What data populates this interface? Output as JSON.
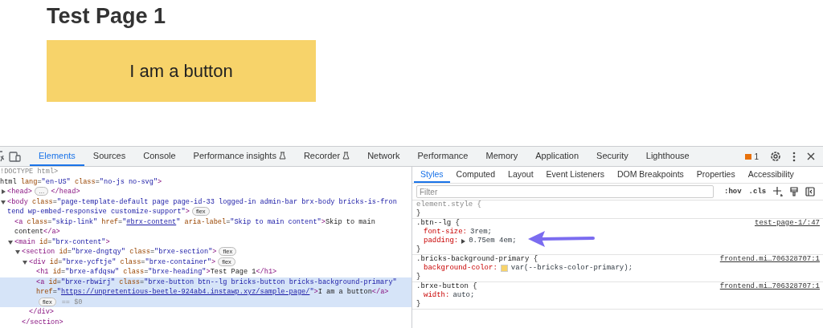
{
  "page": {
    "heading": "Test Page 1",
    "button": "I am a button"
  },
  "devtools": {
    "tabs": [
      {
        "label": "Elements",
        "selected": true,
        "experimental": false
      },
      {
        "label": "Sources",
        "selected": false,
        "experimental": false
      },
      {
        "label": "Console",
        "selected": false,
        "experimental": false
      },
      {
        "label": "Performance insights",
        "selected": false,
        "experimental": true
      },
      {
        "label": "Recorder",
        "selected": false,
        "experimental": true
      },
      {
        "label": "Network",
        "selected": false,
        "experimental": false
      },
      {
        "label": "Performance",
        "selected": false,
        "experimental": false
      },
      {
        "label": "Memory",
        "selected": false,
        "experimental": false
      },
      {
        "label": "Application",
        "selected": false,
        "experimental": false
      },
      {
        "label": "Security",
        "selected": false,
        "experimental": false
      },
      {
        "label": "Lighthouse",
        "selected": false,
        "experimental": false
      }
    ],
    "issues_count": "1"
  },
  "elements": {
    "nodes": [
      {
        "selected": false,
        "lines": [
          [
            {
              "kind": "doctype",
              "text": "!DOCTYPE html>"
            }
          ]
        ]
      },
      {
        "selected": false,
        "lines": [
          [
            {
              "kind": "text",
              "text": "html"
            },
            {
              "kind": "attr",
              "text": " lang"
            },
            {
              "kind": "text",
              "text": "="
            },
            {
              "kind": "value",
              "text": "\"en-US\""
            },
            {
              "kind": "attr",
              "text": " class"
            },
            {
              "kind": "text",
              "text": "="
            },
            {
              "kind": "value",
              "text": "\"no-js no-svg\""
            },
            {
              "kind": "tag",
              "text": ">"
            }
          ]
        ],
        "children": [
          {
            "selected": false,
            "expanded": false,
            "lines": [
              [
                {
                  "kind": "tag",
                  "text": "<head>"
                },
                {
                  "kind": "badge",
                  "text": "…"
                },
                {
                  "kind": "tag",
                  "text": "</head>"
                }
              ]
            ]
          },
          {
            "selected": false,
            "expanded": true,
            "lines": [
              [
                {
                  "kind": "tag",
                  "text": "<body"
                },
                {
                  "kind": "attr",
                  "text": " class"
                },
                {
                  "kind": "text",
                  "text": "="
                },
                {
                  "kind": "value",
                  "text": "\"page-template-default page page-id-33 logged-in admin-bar brx-body bricks-is-fron"
                }
              ],
              [
                {
                  "kind": "value",
                  "text": "tend wp-embed-responsive customize-support\""
                },
                {
                  "kind": "tag",
                  "text": ">"
                },
                {
                  "kind": "badge",
                  "text": "flex"
                }
              ]
            ],
            "children": [
              {
                "selected": false,
                "lines": [
                  [
                    {
                      "kind": "tag",
                      "text": "<a"
                    },
                    {
                      "kind": "attr",
                      "text": " class"
                    },
                    {
                      "kind": "text",
                      "text": "="
                    },
                    {
                      "kind": "value",
                      "text": "\"skip-link\""
                    },
                    {
                      "kind": "attr",
                      "text": " href"
                    },
                    {
                      "kind": "text",
                      "text": "="
                    },
                    {
                      "kind": "value",
                      "text": "\""
                    },
                    {
                      "kind": "link",
                      "text": "#brx-content"
                    },
                    {
                      "kind": "value",
                      "text": "\""
                    },
                    {
                      "kind": "attr",
                      "text": " aria-label"
                    },
                    {
                      "kind": "text",
                      "text": "="
                    },
                    {
                      "kind": "value",
                      "text": "\"Skip to main content\""
                    },
                    {
                      "kind": "tag",
                      "text": ">"
                    },
                    {
                      "kind": "text",
                      "text": "Skip to main"
                    }
                  ],
                  [
                    {
                      "kind": "text",
                      "text": "content"
                    },
                    {
                      "kind": "tag",
                      "text": "</a>"
                    }
                  ]
                ]
              },
              {
                "selected": false,
                "expanded": true,
                "lines": [
                  [
                    {
                      "kind": "tag",
                      "text": "<main"
                    },
                    {
                      "kind": "attr",
                      "text": " id"
                    },
                    {
                      "kind": "text",
                      "text": "="
                    },
                    {
                      "kind": "value",
                      "text": "\"brx-content\""
                    },
                    {
                      "kind": "tag",
                      "text": ">"
                    }
                  ]
                ],
                "children": [
                  {
                    "selected": false,
                    "expanded": true,
                    "lines": [
                      [
                        {
                          "kind": "tag",
                          "text": "<section"
                        },
                        {
                          "kind": "attr",
                          "text": " id"
                        },
                        {
                          "kind": "text",
                          "text": "="
                        },
                        {
                          "kind": "value",
                          "text": "\"brxe-dngtqy\""
                        },
                        {
                          "kind": "attr",
                          "text": " class"
                        },
                        {
                          "kind": "text",
                          "text": "="
                        },
                        {
                          "kind": "value",
                          "text": "\"brxe-section\""
                        },
                        {
                          "kind": "tag",
                          "text": ">"
                        },
                        {
                          "kind": "badge",
                          "text": "flex"
                        }
                      ]
                    ],
                    "close": "</section>",
                    "children": [
                      {
                        "selected": false,
                        "expanded": true,
                        "lines": [
                          [
                            {
                              "kind": "tag",
                              "text": "<div"
                            },
                            {
                              "kind": "attr",
                              "text": " id"
                            },
                            {
                              "kind": "text",
                              "text": "="
                            },
                            {
                              "kind": "value",
                              "text": "\"brxe-ycftje\""
                            },
                            {
                              "kind": "attr",
                              "text": " class"
                            },
                            {
                              "kind": "text",
                              "text": "="
                            },
                            {
                              "kind": "value",
                              "text": "\"brxe-container\""
                            },
                            {
                              "kind": "tag",
                              "text": ">"
                            },
                            {
                              "kind": "badge",
                              "text": "flex"
                            }
                          ]
                        ],
                        "close": "</div>",
                        "children": [
                          {
                            "selected": false,
                            "lines": [
                              [
                                {
                                  "kind": "tag",
                                  "text": "<h1"
                                },
                                {
                                  "kind": "attr",
                                  "text": " id"
                                },
                                {
                                  "kind": "text",
                                  "text": "="
                                },
                                {
                                  "kind": "value",
                                  "text": "\"brxe-afdqsw\""
                                },
                                {
                                  "kind": "attr",
                                  "text": " class"
                                },
                                {
                                  "kind": "text",
                                  "text": "="
                                },
                                {
                                  "kind": "value",
                                  "text": "\"brxe-heading\""
                                },
                                {
                                  "kind": "tag",
                                  "text": ">"
                                },
                                {
                                  "kind": "text",
                                  "text": "Test Page 1"
                                },
                                {
                                  "kind": "tag",
                                  "text": "</h1>"
                                }
                              ]
                            ]
                          },
                          {
                            "selected": true,
                            "lines": [
                              [
                                {
                                  "kind": "tag",
                                  "text": "<a"
                                },
                                {
                                  "kind": "attr",
                                  "text": " id"
                                },
                                {
                                  "kind": "text",
                                  "text": "="
                                },
                                {
                                  "kind": "value",
                                  "text": "\"brxe-rbwirj\""
                                },
                                {
                                  "kind": "attr",
                                  "text": " class"
                                },
                                {
                                  "kind": "text",
                                  "text": "="
                                },
                                {
                                  "kind": "value",
                                  "text": "\"brxe-button btn--lg bricks-button bricks-background-primary\""
                                }
                              ],
                              [
                                {
                                  "kind": "attr",
                                  "text": "href"
                                },
                                {
                                  "kind": "text",
                                  "text": "="
                                },
                                {
                                  "kind": "value",
                                  "text": "\""
                                },
                                {
                                  "kind": "link",
                                  "text": "https://unpretentious-beetle-924ab4.instawp.xyz/sample-page/"
                                },
                                {
                                  "kind": "value",
                                  "text": "\""
                                },
                                {
                                  "kind": "tag",
                                  "text": ">"
                                },
                                {
                                  "kind": "text",
                                  "text": "I am a button"
                                },
                                {
                                  "kind": "tag",
                                  "text": "</a>"
                                }
                              ],
                              [
                                {
                                  "kind": "badge",
                                  "text": "flex"
                                },
                                {
                                  "kind": "dollar",
                                  "text": "== $0"
                                }
                              ]
                            ]
                          }
                        ]
                      }
                    ]
                  }
                ]
              }
            ]
          }
        ]
      }
    ]
  },
  "styles": {
    "tabs": [
      {
        "label": "Styles",
        "selected": true
      },
      {
        "label": "Computed",
        "selected": false
      },
      {
        "label": "Layout",
        "selected": false
      },
      {
        "label": "Event Listeners",
        "selected": false
      },
      {
        "label": "DOM Breakpoints",
        "selected": false
      },
      {
        "label": "Properties",
        "selected": false
      },
      {
        "label": "Accessibility",
        "selected": false
      }
    ],
    "filter": {
      "placeholder": "Filter"
    },
    "toggles": [
      ":hov",
      ".cls"
    ],
    "rules": [
      {
        "kind": "inline",
        "selector": "element.style {",
        "close": "}"
      },
      {
        "kind": "rule",
        "selector": ".btn--lg {",
        "source": "test-page-1/:47",
        "close": "}",
        "declarations": [
          {
            "property": "font-size:",
            "value": "3rem;",
            "expandable": false
          },
          {
            "property": "padding:",
            "value": "0.75em 4em;",
            "expandable": true
          }
        ]
      },
      {
        "kind": "rule",
        "selector": ".bricks-background-primary {",
        "source": "frontend.mi…706328707:1",
        "close": "}",
        "declarations": [
          {
            "property": "background-color:",
            "value": "var(--bricks-color-primary);",
            "expandable": false,
            "swatch": true
          }
        ]
      },
      {
        "kind": "rule",
        "selector": ".brxe-button {",
        "source": "frontend.mi…706328707:1",
        "close": "}",
        "declarations": [
          {
            "property": "width:",
            "value": "auto;",
            "expandable": false
          }
        ]
      }
    ]
  }
}
